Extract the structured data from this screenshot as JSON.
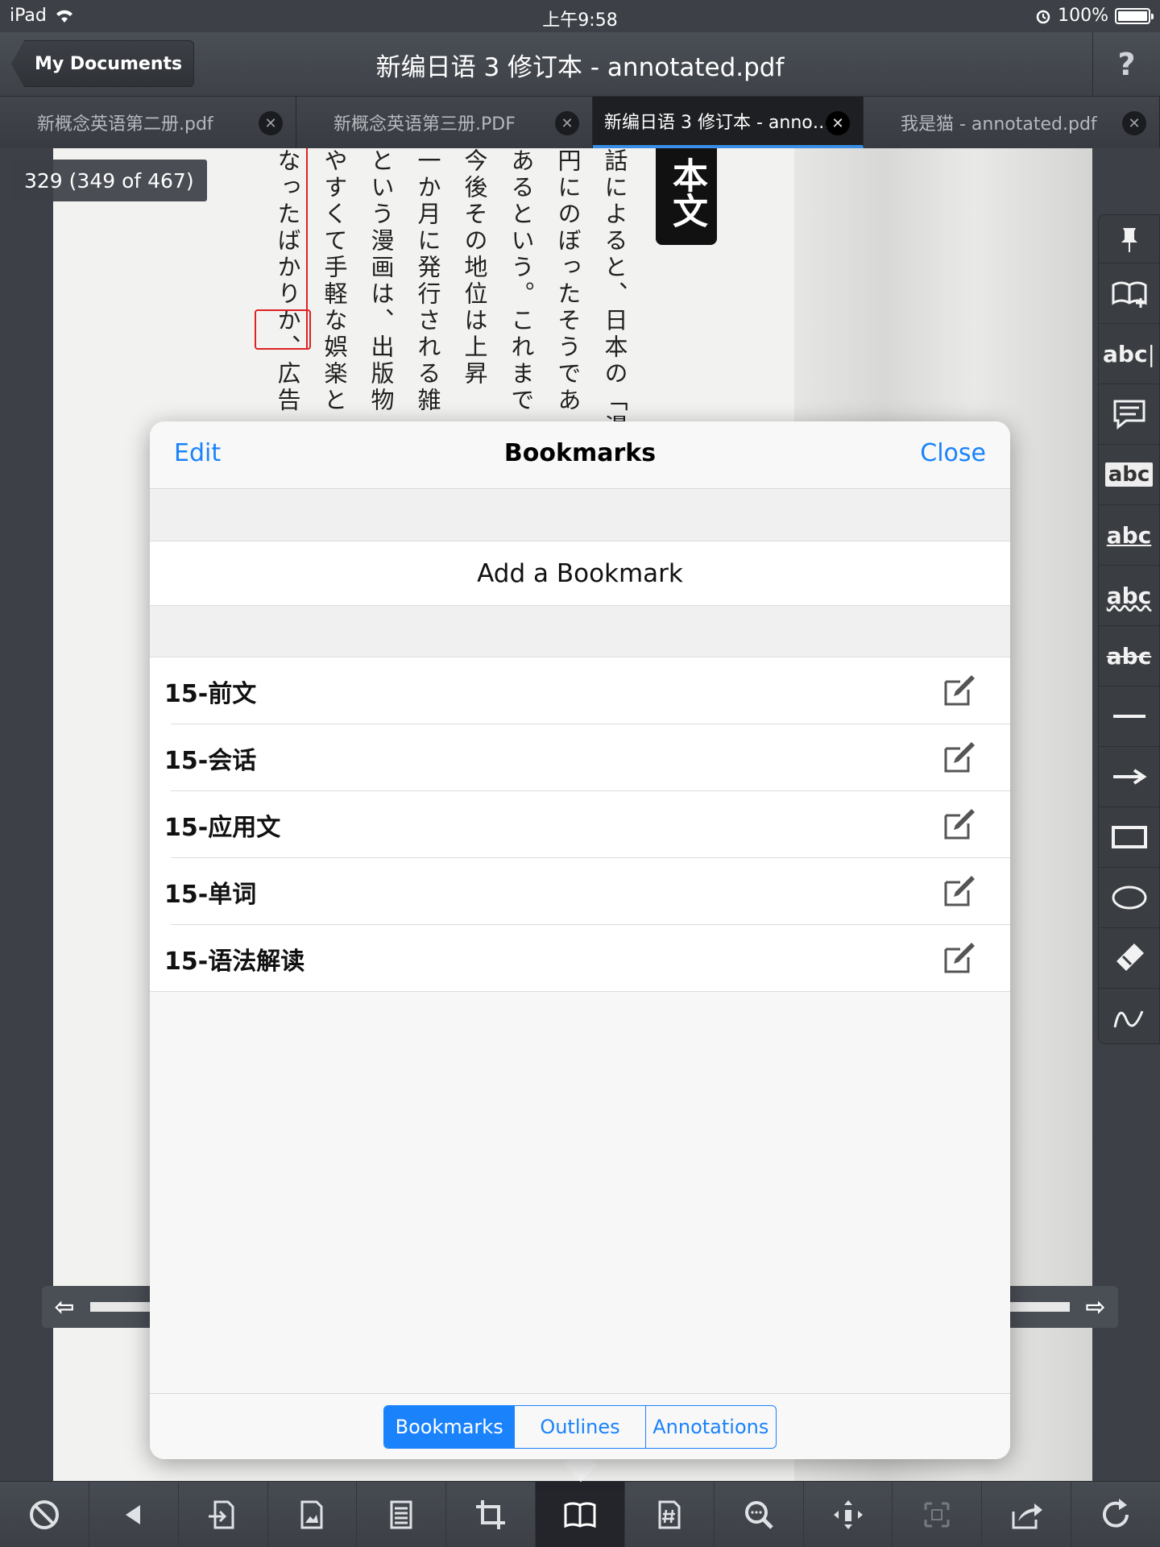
{
  "status_bar": {
    "device": "iPad",
    "time": "上午9:58",
    "battery": "100%"
  },
  "navbar": {
    "back_label": "My Documents",
    "title": "新编日语 3 修订本 - annotated.pdf",
    "help": "?"
  },
  "tabs": [
    {
      "label": "新概念英语第二册.pdf",
      "active": false
    },
    {
      "label": "新概念英语第三册.PDF",
      "active": false
    },
    {
      "label": "新编日语 3 修订本 - anno…",
      "active": true
    },
    {
      "label": "我是猫 - annotated.pdf",
      "active": false
    }
  ],
  "document": {
    "page_indicator": "329 (349 of 467)",
    "heading_block": "本文",
    "columns": [
      "話によると、日本の「漫",
      "円にのぼったそうであ",
      "あるという。これまで",
      "今後その地位は上昇",
      "一か月に発行される雑",
      "という漫画は、出版物",
      "やすくて手軽な娯楽と",
      "なったばかりか、広告"
    ]
  },
  "annotation_tools": [
    "pin-icon",
    "add-bookmark-icon",
    "text-insert-icon",
    "comment-icon",
    "highlight-icon",
    "underline-icon",
    "squiggly-icon",
    "strikethrough-icon",
    "line-icon",
    "arrow-icon",
    "rectangle-icon",
    "ellipse-icon",
    "eraser-icon",
    "freehand-icon"
  ],
  "annotation_labels": {
    "abc": "abc"
  },
  "bottom_toolbar": [
    "no-entry-icon",
    "back-icon",
    "export-page-icon",
    "image-icon",
    "page-layout-icon",
    "crop-icon",
    "book-icon",
    "page-number-icon",
    "search-icon",
    "move-icon",
    "fullscreen-icon",
    "share-icon",
    "refresh-icon"
  ],
  "modal": {
    "edit": "Edit",
    "title": "Bookmarks",
    "close": "Close",
    "add_bookmark": "Add a Bookmark",
    "bookmarks": [
      "15-前文",
      "15-会话",
      "15-应用文",
      "15-单词",
      "15-语法解读"
    ],
    "segments": {
      "bookmarks": "Bookmarks",
      "outlines": "Outlines",
      "annotations": "Annotations"
    }
  },
  "colors": {
    "accent": "#1a82fb",
    "toolbar": "#3d4147"
  }
}
